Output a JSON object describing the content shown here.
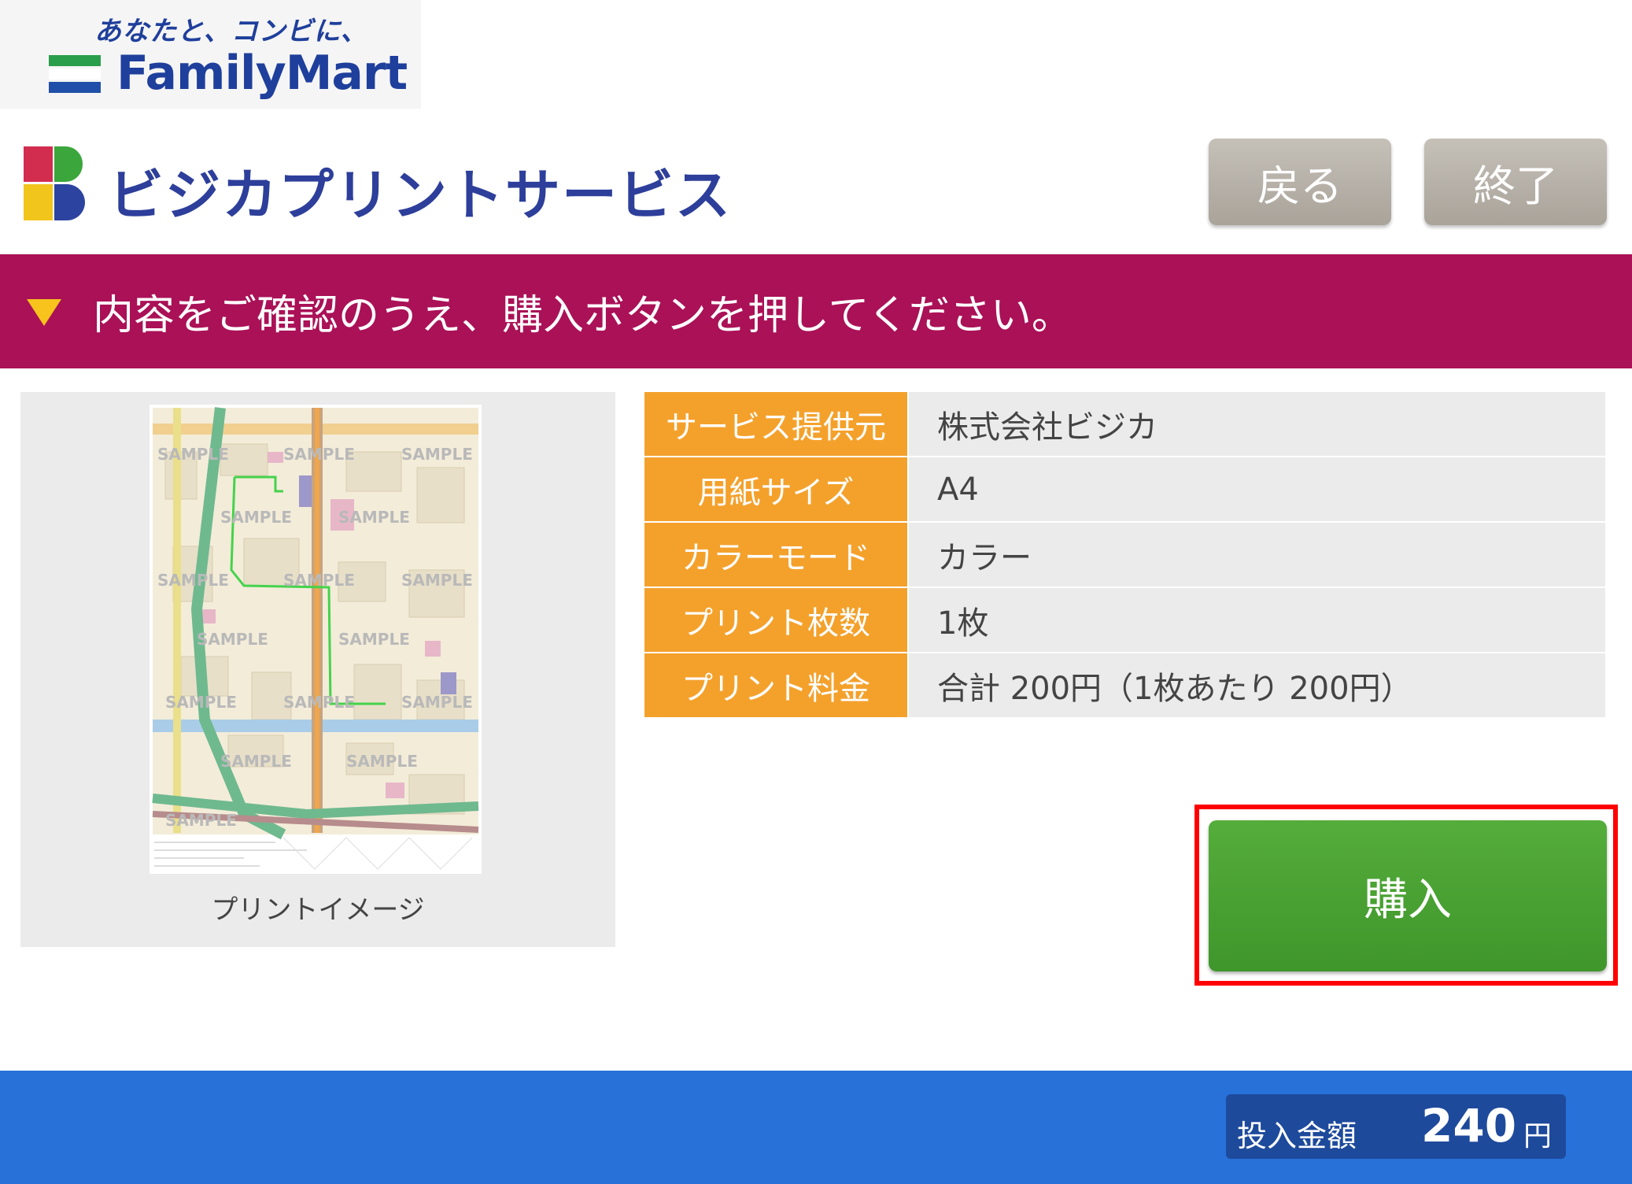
{
  "brand": {
    "tagline": "あなたと、コンビに、",
    "name": "FamilyMart",
    "stripe_colors": [
      "#2a9e4a",
      "#ffffff",
      "#1f4fa8"
    ]
  },
  "header": {
    "service_title": "ビジカプリントサービス",
    "logo_colors": [
      "#d22d4f",
      "#3aa63c",
      "#f2c51c",
      "#2c44a0"
    ],
    "back_label": "戻る",
    "end_label": "終了"
  },
  "banner": {
    "text": "内容をご確認のうえ、購入ボタンを押してください。",
    "background": "#aa1157",
    "marker_color": "#f7c31c"
  },
  "preview": {
    "caption": "プリントイメージ",
    "watermark": "SAMPLE"
  },
  "details": [
    {
      "label": "サービス提供元",
      "value": "株式会社ビジカ"
    },
    {
      "label": "用紙サイズ",
      "value": "A4"
    },
    {
      "label": "カラーモード",
      "value": "カラー"
    },
    {
      "label": "プリント枚数",
      "value": "1枚"
    },
    {
      "label": "プリント料金",
      "value": "合計 200円（1枚あたり 200円）"
    }
  ],
  "buy": {
    "label": "購入",
    "color": "#4aa333",
    "highlight_color": "#ff0000"
  },
  "footer": {
    "money_label": "投入金額",
    "money_value": "240",
    "money_unit": "円",
    "background": "#2771d9"
  }
}
